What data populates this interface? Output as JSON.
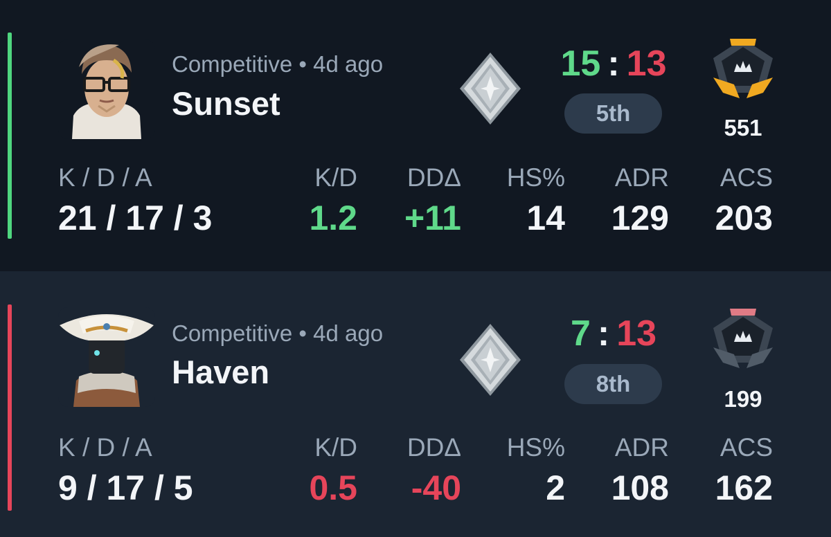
{
  "matches": [
    {
      "result": "win",
      "stripe_color": "#4fd67f",
      "mode": "Competitive",
      "separator": "•",
      "time_ago": "4d ago",
      "map": "Sunset",
      "agent_icon": "agent-portrait-icon",
      "rank_icon": "silver-rank-icon",
      "score_team": "15",
      "score_sep": ":",
      "score_enemy": "13",
      "placement": "5th",
      "tier_icon": "tier-emblem-gold-icon",
      "tier_accent": "#f0a921",
      "rr": "551",
      "stats": {
        "kda_label": "K / D / A",
        "kda_value": "21 / 17 / 3",
        "kd_label": "K/D",
        "kd_value": "1.2",
        "dd_label": "DDΔ",
        "dd_value": "+11",
        "hs_label": "HS%",
        "hs_value": "14",
        "adr_label": "ADR",
        "adr_value": "129",
        "acs_label": "ACS",
        "acs_value": "203"
      }
    },
    {
      "result": "loss",
      "stripe_color": "#e6455a",
      "mode": "Competitive",
      "separator": "•",
      "time_ago": "4d ago",
      "map": "Haven",
      "agent_icon": "agent-portrait-icon",
      "rank_icon": "silver-rank-icon",
      "score_team": "7",
      "score_sep": ":",
      "score_enemy": "13",
      "placement": "8th",
      "tier_icon": "tier-emblem-red-icon",
      "tier_accent": "#e07b85",
      "rr": "199",
      "stats": {
        "kda_label": "K / D / A",
        "kda_value": "9 / 17 / 5",
        "kd_label": "K/D",
        "kd_value": "0.5",
        "dd_label": "DDΔ",
        "dd_value": "-40",
        "hs_label": "HS%",
        "hs_value": "2",
        "adr_label": "ADR",
        "adr_value": "108",
        "acs_label": "ACS",
        "acs_value": "162"
      }
    }
  ],
  "colors": {
    "positive": "#5fd98a",
    "negative": "#e6455a",
    "muted_text": "#9aa8b8",
    "pill_bg": "#2d3b4c"
  }
}
